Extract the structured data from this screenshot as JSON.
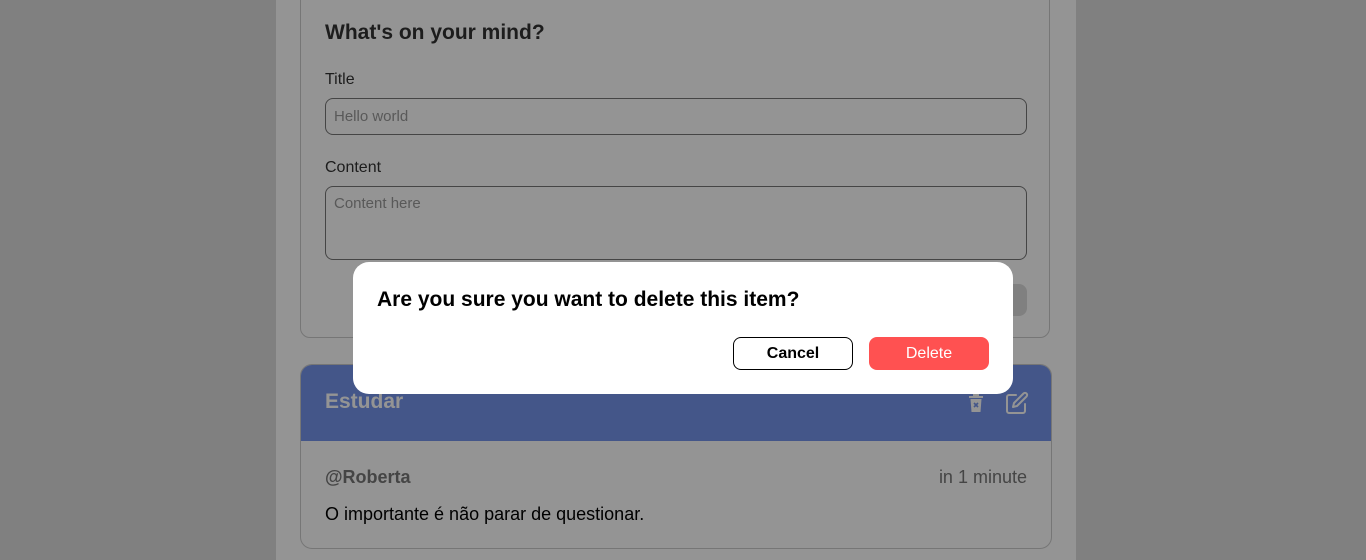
{
  "form": {
    "heading": "What's on your mind?",
    "title_label": "Title",
    "title_placeholder": "Hello world",
    "content_label": "Content",
    "content_placeholder": "Content here"
  },
  "post": {
    "title": "Estudar",
    "author": "@Roberta",
    "time": "in 1 minute",
    "content": "O importante é não parar de questionar.",
    "icons": {
      "delete": "trash-icon",
      "edit": "edit-icon"
    }
  },
  "modal": {
    "title": "Are you sure you want to delete this item?",
    "cancel_label": "Cancel",
    "delete_label": "Delete"
  },
  "colors": {
    "accent": "#7695ec",
    "danger": "#ff5151",
    "overlay": "rgba(0,0,0,0.42)"
  }
}
